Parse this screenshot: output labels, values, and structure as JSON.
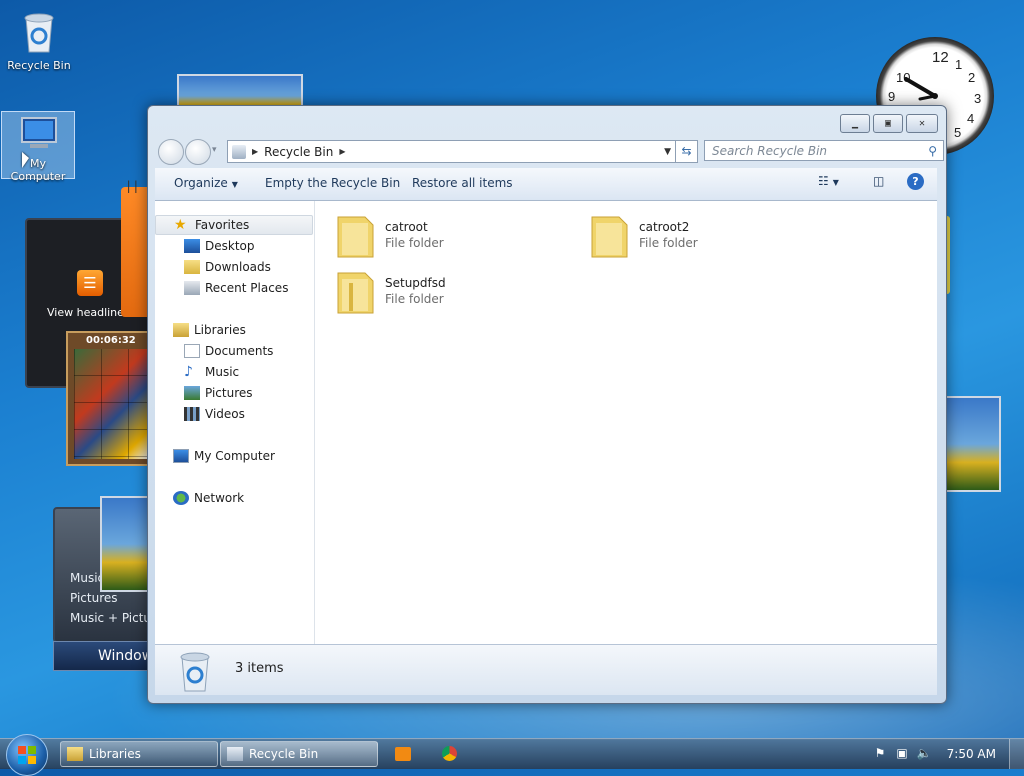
{
  "desktop": {
    "icons": [
      {
        "label": "Recycle Bin"
      },
      {
        "label": "My Computer"
      }
    ],
    "gadgets": {
      "feed_text": "View headlines",
      "puzzle_timer": "00:06:32",
      "media_center_items": [
        "Music",
        "Pictures",
        "Music + Pictures"
      ],
      "media_center_title": "Windows Media Center",
      "clock_numbers": [
        "12",
        "1",
        "2",
        "3",
        "4",
        "5",
        "9",
        "10"
      ]
    }
  },
  "window": {
    "title": "Recycle Bin",
    "address": {
      "segments": [
        "Recycle Bin"
      ]
    },
    "search": {
      "placeholder": "Search Recycle Bin"
    },
    "toolbar": {
      "organize": "Organize",
      "empty": "Empty the Recycle Bin",
      "restore": "Restore all items"
    },
    "nav": {
      "favorites": "Favorites",
      "favorites_items": [
        "Desktop",
        "Downloads",
        "Recent Places"
      ],
      "libraries": "Libraries",
      "libraries_items": [
        "Documents",
        "Music",
        "Pictures",
        "Videos"
      ],
      "computer": "My Computer",
      "network": "Network"
    },
    "files": [
      {
        "name": "catroot",
        "type": "File folder"
      },
      {
        "name": "catroot2",
        "type": "File folder"
      },
      {
        "name": "Setupdfsd",
        "type": "File folder"
      }
    ],
    "status": {
      "count": "3 items"
    }
  },
  "taskbar": {
    "buttons": [
      {
        "label": "Libraries"
      },
      {
        "label": "Recycle Bin"
      }
    ],
    "clock": "7:50 AM"
  },
  "colors": {
    "desktop_blue": "#1b7fd0",
    "window_frame": "#c6d7ea",
    "command_text": "#1e395b",
    "folder_yellow": "#f0d46a"
  }
}
